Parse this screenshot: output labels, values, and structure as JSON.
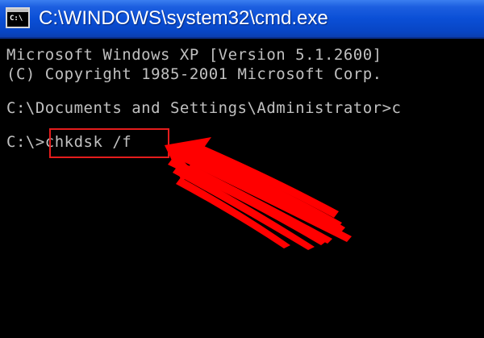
{
  "window": {
    "title": "C:\\WINDOWS\\system32\\cmd.exe",
    "icon_label": "C:\\",
    "icon": "cmd-icon"
  },
  "console": {
    "lines": [
      "Microsoft Windows XP [Version 5.1.2600]",
      "(C) Copyright 1985-2001 Microsoft Corp.",
      "C:\\Documents and Settings\\Administrator>c",
      "C:\\>chkdsk /f"
    ],
    "highlighted_command": "chkdsk /f"
  },
  "annotation": {
    "arrow_color": "#ff0000",
    "box_color": "#e51c1c"
  },
  "colors": {
    "titlebar": "#0a4fd6",
    "console_bg": "#000000",
    "console_text": "#c0c0c0"
  }
}
